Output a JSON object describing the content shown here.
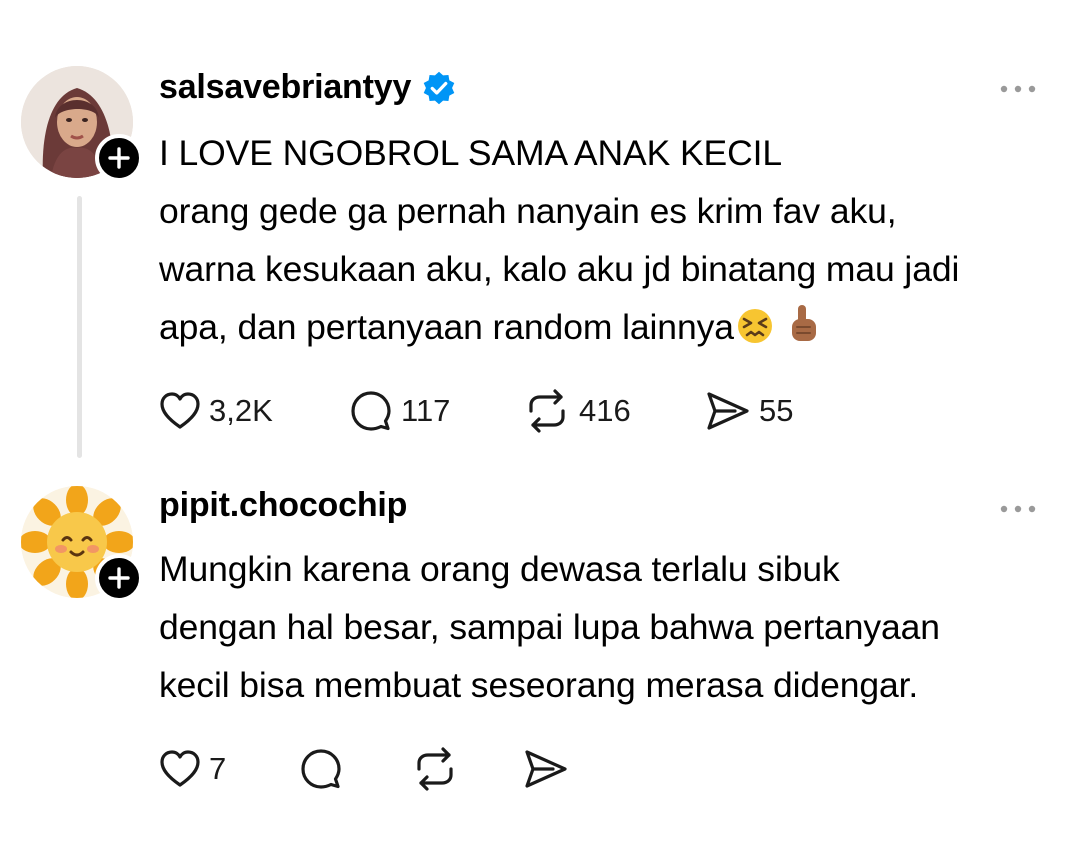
{
  "posts": [
    {
      "username": "salsavebriantyy",
      "verified": true,
      "text_lines": [
        "I LOVE NGOBROL SAMA ANAK KECIL",
        "orang gede ga pernah nanyain es krim fav aku,",
        "warna kesukaan aku, kalo aku jd binatang mau jadi",
        "apa, dan pertanyaan random lainnya"
      ],
      "emojis": [
        "confounded-face",
        "index-pointing-up-medium-dark-skin"
      ],
      "likes": "3,2K",
      "replies": "117",
      "reposts": "416",
      "shares": "55"
    },
    {
      "username": "pipit.chocochip",
      "verified": false,
      "text_lines": [
        "Mungkin karena orang dewasa terlalu sibuk",
        "dengan hal besar, sampai lupa bahwa pertanyaan",
        "kecil bisa membuat seseorang merasa didengar."
      ],
      "likes": "7",
      "replies": "",
      "reposts": "",
      "shares": ""
    }
  ],
  "icons": {
    "verified_color": "#0095f6",
    "more": "more-dots-icon",
    "like": "heart-icon",
    "reply": "comment-icon",
    "repost": "repost-icon",
    "share": "send-icon",
    "follow": "plus-icon"
  }
}
